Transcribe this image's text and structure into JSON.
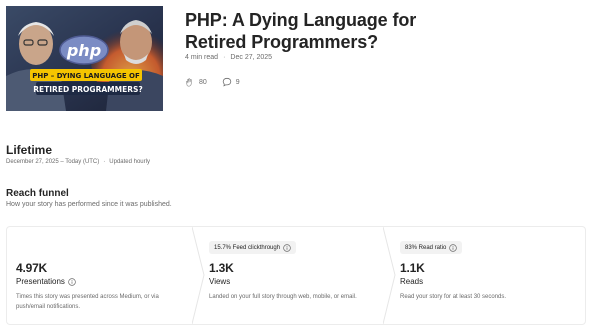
{
  "story": {
    "title": "PHP: A Dying Language for Retired Programmers?",
    "read_time": "4 min read",
    "date": "Dec 27, 2025",
    "claps": "80",
    "responses": "9",
    "thumbnail": {
      "logo_text": "php",
      "banner_line1": "PHP – DYING LANGUAGE OF",
      "banner_line2": "RETIRED PROGRAMMERS?"
    }
  },
  "lifetime": {
    "title": "Lifetime",
    "range": "December 27, 2025 – Today (UTC)",
    "updated": "Updated hourly"
  },
  "funnel": {
    "title": "Reach funnel",
    "subtitle": "How your story has performed since it was published.",
    "columns": [
      {
        "badge": "",
        "value": "4.97K",
        "label": "Presentations",
        "description_line1": "Times this story was presented across Medium, or via",
        "description_line2": "push/email notifications."
      },
      {
        "badge": "15.7% Feed clickthrough",
        "value": "1.3K",
        "label": "Views",
        "description_line1": "Landed on your full story through web, mobile, or email.",
        "description_line2": ""
      },
      {
        "badge": "83% Read ratio",
        "value": "1.1K",
        "label": "Reads",
        "description_line1": "Read your story for at least 30 seconds.",
        "description_line2": ""
      }
    ]
  },
  "colors": {
    "text": "#242424",
    "muted": "#6b6b6b",
    "badge_bg": "#f2f2f2",
    "border": "#ececec",
    "php_blue": "#7b8cc4",
    "banner_yellow": "#f5c400"
  },
  "icons": [
    "clap-icon",
    "comment-icon",
    "info-icon"
  ]
}
